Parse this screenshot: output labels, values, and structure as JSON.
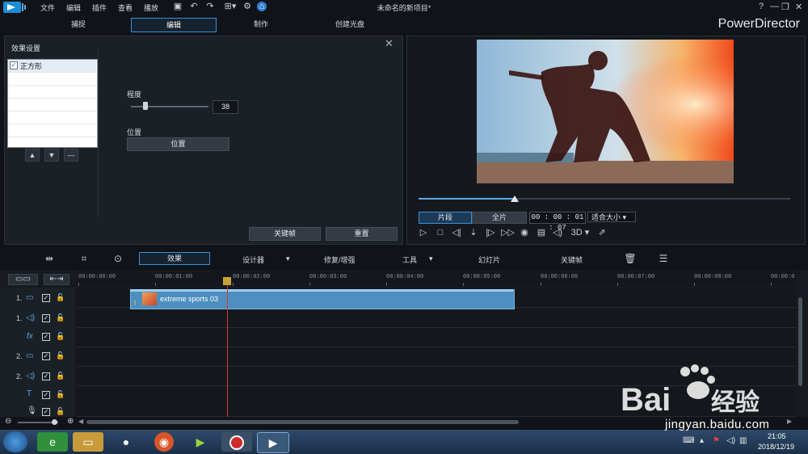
{
  "menu": {
    "items": [
      "文件",
      "编辑",
      "插件",
      "查看",
      "播放"
    ]
  },
  "document_title": "未命名的新项目*",
  "window_controls": [
    "?",
    "—",
    "❐",
    "✕"
  ],
  "mode_tabs": [
    {
      "label": "捕捉",
      "active": false
    },
    {
      "label": "编辑",
      "active": true
    },
    {
      "label": "制作",
      "active": false
    },
    {
      "label": "创建光盘",
      "active": false
    }
  ],
  "brand": "PowerDirector",
  "effect_panel": {
    "title": "效果设置",
    "effect_item": "正方形",
    "effect_checked": true,
    "degree_label": "程度",
    "degree_value": "38",
    "degree_fraction": 0.17,
    "position_label": "位置",
    "position_button": "位置",
    "keyframe_button": "关键帧",
    "reset_button": "重置"
  },
  "preview": {
    "clip_mode": "片段",
    "full_mode": "全片",
    "timecode": "00 : 00 : 01 : 07",
    "fit": "适合大小",
    "progress_fraction": 0.26,
    "three_d": "3D"
  },
  "toolbar": {
    "effect": "效果",
    "designer": "设计器",
    "repair": "修复/增强",
    "tools": "工具",
    "slideshow": "幻灯片",
    "keyframe": "关键帧"
  },
  "timeline": {
    "ticks": [
      "00:00:00:00",
      "00:00:01:00",
      "00:00:02:00",
      "00:00:03:00",
      "00:00:04:00",
      "00:00:05:00",
      "00:00:06:00",
      "00:00:07:00",
      "00:00:08:00",
      "00:00:0"
    ],
    "tracks": [
      {
        "number": "1.",
        "type": "video"
      },
      {
        "number": "1.",
        "type": "audio"
      },
      {
        "number": "",
        "type": "fx"
      },
      {
        "number": "2.",
        "type": "video"
      },
      {
        "number": "2.",
        "type": "audio"
      },
      {
        "number": "",
        "type": "title"
      },
      {
        "number": "",
        "type": "voice"
      }
    ],
    "clip_name": "extreme sports 03"
  },
  "taskbar": {
    "time": "21:05",
    "date": "2018/12/19"
  },
  "watermark": {
    "text": "Bai经验",
    "url": "jingyan.baidu.com"
  },
  "colors": {
    "accent": "#3d8fd6",
    "clip": "#4d8fbf",
    "playhead": "#d13b3b"
  }
}
